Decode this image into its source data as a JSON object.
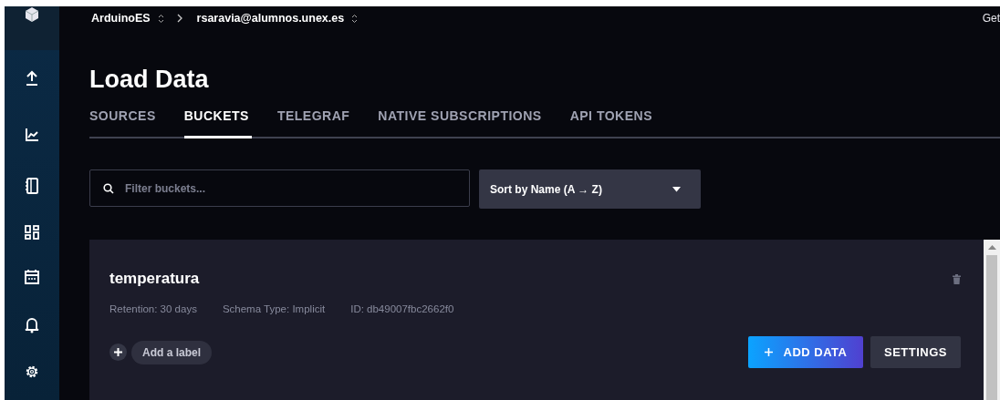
{
  "breadcrumb": {
    "organization": "ArduinoES",
    "user": "rsaravia@alumnos.unex.es"
  },
  "header_link": "Get",
  "title": "Load Data",
  "tabs": [
    {
      "label": "SOURCES",
      "selected": false
    },
    {
      "label": "BUCKETS",
      "selected": true
    },
    {
      "label": "TELEGRAF",
      "selected": false
    },
    {
      "label": "NATIVE SUBSCRIPTIONS",
      "selected": false
    },
    {
      "label": "API TOKENS",
      "selected": false
    }
  ],
  "search": {
    "placeholder": "Filter buckets..."
  },
  "sort": {
    "value": "Sort by Name (A → Z)"
  },
  "buckets": [
    {
      "name": "temperatura",
      "retention": "Retention: 30 days",
      "schema": "Schema Type: Implicit",
      "id": "ID: db49007fbc2662f0",
      "add_label": "Add a label",
      "add_data": "ADD DATA",
      "settings": "SETTINGS"
    }
  ]
}
